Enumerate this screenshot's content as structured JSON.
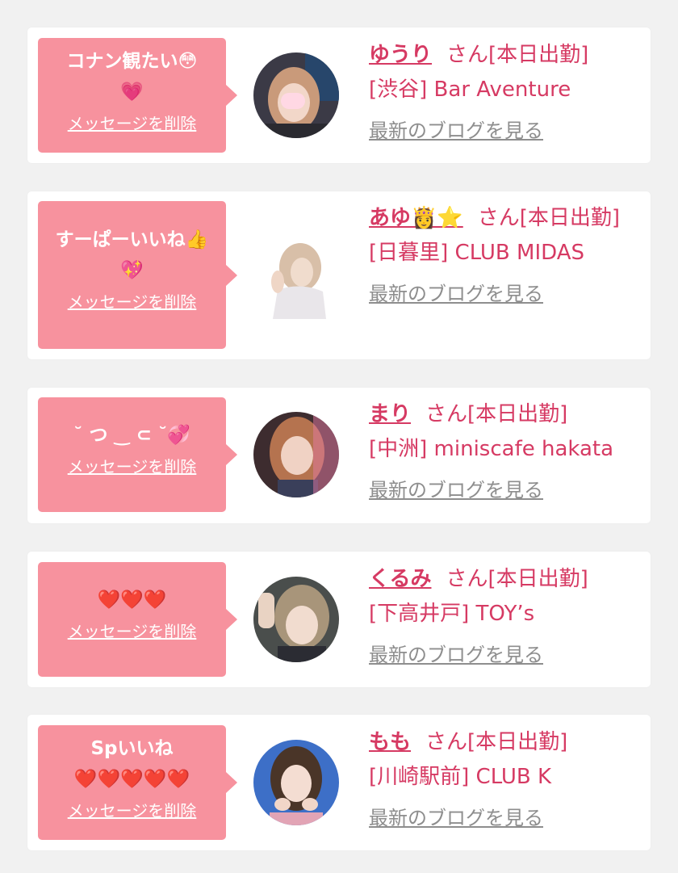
{
  "delete_label": "メッセージを削除",
  "blog_label": "最新のブログを見る",
  "colors": {
    "accent": "#d63a63",
    "bubble": "#f7929e",
    "muted": "#8e8e8e",
    "background": "#f1f1f1"
  },
  "entries": [
    {
      "message_line1": "コナン観たい😳",
      "message_line2": "💗",
      "name": "ゆうり",
      "suffix": "さん[本日出勤]",
      "shop": "[渋谷] Bar Aventure"
    },
    {
      "message_line1": "すーぱーいいね👍",
      "message_line2": "💖",
      "name": "あゆ👸⭐",
      "suffix": "さん[本日出勤]",
      "shop": "[日暮里] CLUB MIDAS"
    },
    {
      "message_line1": "˘ つ ‿ ⊂ ˘💞",
      "message_line2": "",
      "name": "まり",
      "suffix": "さん[本日出勤]",
      "shop": "[中洲] miniscafe hakata"
    },
    {
      "message_line1": "❤️❤️❤️",
      "message_line2": "",
      "name": "くるみ",
      "suffix": "さん[本日出勤]",
      "shop": "[下高井戸] TOY’s"
    },
    {
      "message_line1": "Spいいね",
      "message_line2": "❤️❤️❤️❤️❤️",
      "name": "もも",
      "suffix": "さん[本日出勤]",
      "shop": "[川崎駅前] CLUB K"
    }
  ]
}
